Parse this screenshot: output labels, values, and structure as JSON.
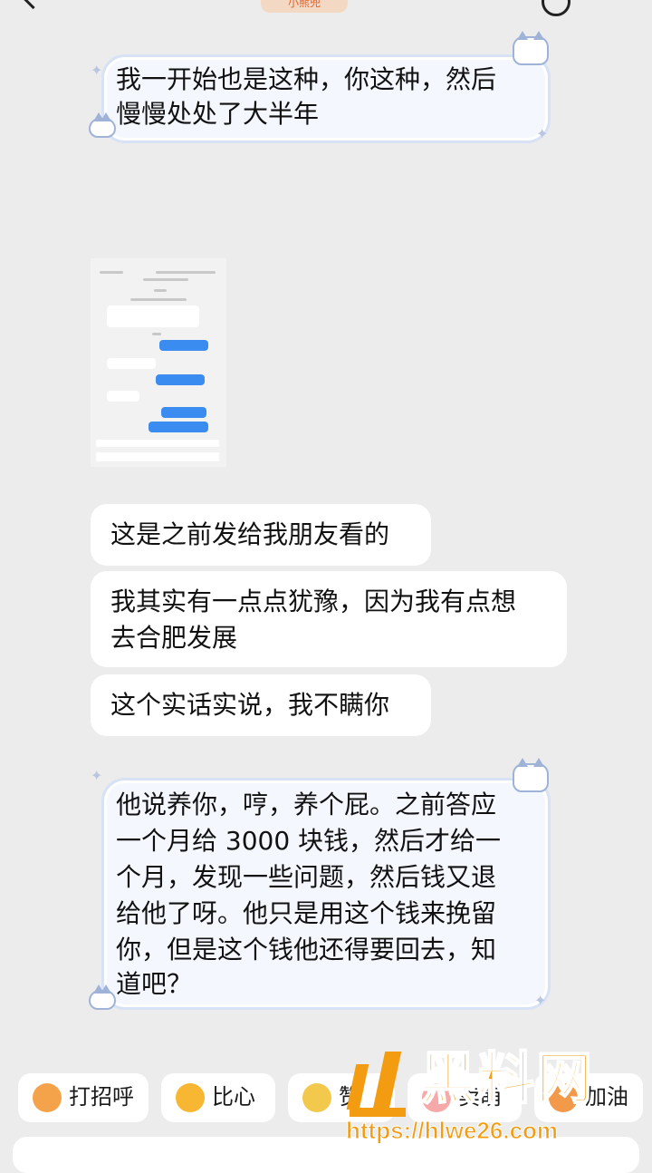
{
  "header": {
    "title": "小熊兜"
  },
  "messages": {
    "m1": [
      "我一开始也是这种，你这种，然后",
      "慢慢处处了大半年"
    ],
    "m2": "这是之前发给我朋友看的",
    "m3": [
      "我其实有一点点犹豫，因为我有点想",
      "去合肥发展"
    ],
    "m4": "这个实话实说，我不瞒你",
    "m5": [
      "他说养你，哼，养个屁。之前答应",
      "一个月给 3000 块钱，然后才给一",
      "个月，发现一些问题，然后钱又退",
      "给他了呀。他只是用这个钱来挽留",
      "你，但是这个钱他还得要回去，知",
      "道吧？"
    ]
  },
  "quick_replies": [
    "打招呼",
    "比心",
    "赞",
    "卖萌",
    "加油"
  ],
  "watermark": {
    "title": "黑料网",
    "url": "https://hlwe26.com"
  }
}
